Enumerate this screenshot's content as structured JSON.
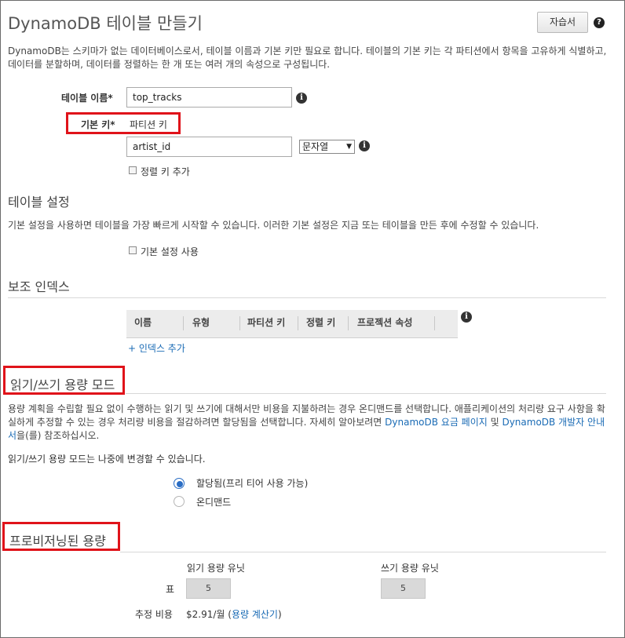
{
  "page": {
    "title": "DynamoDB 테이블 만들기",
    "help_button": "자습서",
    "help_icon": "?",
    "intro": "DynamoDB는 스키마가 없는 데이터베이스로서, 테이블 이름과 기본 키만 필요로 합니다. 테이블의 기본 키는 각 파티션에서 항목을 고유하게 식별하고, 데이터를 분할하며, 데이터를 정렬하는 한 개 또는 여러 개의 속성으로 구성됩니다."
  },
  "table_name": {
    "label": "테이블 이름*",
    "value": "top_tracks"
  },
  "primary_key": {
    "label": "기본 키*",
    "partition_label": "파티션 키",
    "partition_value": "artist_id",
    "type_selected": "문자열",
    "add_sort_key": "정렬 키 추가"
  },
  "table_settings": {
    "title": "테이블 설정",
    "description": "기본 설정을 사용하면 테이블을 가장 빠르게 시작할 수 있습니다. 이러한 기본 설정은 지금 또는 테이블을 만든 후에 수정할 수 있습니다.",
    "use_default": "기본 설정 사용"
  },
  "secondary_indexes": {
    "title": "보조 인덱스",
    "columns": [
      "이름",
      "유형",
      "파티션 키",
      "정렬 키",
      "프로젝션 속성"
    ],
    "add_index": "+ 인덱스 추가"
  },
  "capacity_mode": {
    "title": "읽기/쓰기 용량 모드",
    "desc_part1": "용량 계획을 수립할 필요 없이 수행하는 읽기 및 쓰기에 대해서만 비용을 지불하려는 경우 온디맨드를 선택합니다. 애플리케이션의 처리량 요구 사항을 확실하게 추정할 수 있는 경우 처리량 비용을 절감하려면 할당됨을 선택합니다. 자세히 알아보려면 ",
    "link_pricing": "DynamoDB 요금 페이지",
    "desc_and": " 및 ",
    "link_guide": "DynamoDB 개발자 안내서",
    "desc_end": "을(를) 참조하십시오.",
    "change_note": "읽기/쓰기 용량 모드는 나중에 변경할 수 있습니다.",
    "option_provisioned": "할당됨(프리 티어 사용 가능)",
    "option_on_demand": "온디맨드",
    "selected": "provisioned"
  },
  "provisioned_capacity": {
    "title": "프로비저닝된 용량",
    "read_header": "읽기 용량 유닛",
    "write_header": "쓰기 용량 유닛",
    "row_label": "표",
    "read_value": "5",
    "write_value": "5",
    "estimated_label": "추정 비용",
    "estimated_value": "$2.91/월 (",
    "calculator_link": "용량 계산기",
    "estimated_close": ")"
  },
  "colors": {
    "highlight_red": "#e0131a",
    "link_blue": "#1a6bb5",
    "radio_blue": "#2a6dc4"
  }
}
